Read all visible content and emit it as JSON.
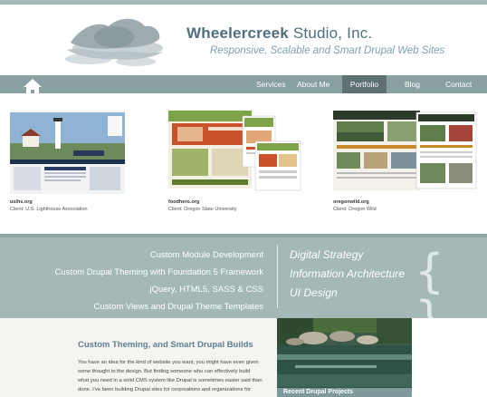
{
  "brand": {
    "title_strong": "Wheelercreek",
    "title_rest": " Studio, Inc.",
    "tagline": "Responsive, Scalable and Smart Drupal Web Sites"
  },
  "nav": {
    "items": [
      {
        "label": "Services",
        "active": false
      },
      {
        "label": "About Me",
        "active": false
      },
      {
        "label": "Portfolio",
        "active": true
      },
      {
        "label": "Blog",
        "active": false
      },
      {
        "label": "Contact",
        "active": false
      }
    ]
  },
  "portfolio": [
    {
      "title": "uslhs.org",
      "client": "Client: U.S. Lighthouse Association"
    },
    {
      "title": "foodhero.org",
      "client": "Client: Oregon State University"
    },
    {
      "title": "oregonwild.org",
      "client": "Client: Oregon Wild"
    }
  ],
  "services": {
    "items": [
      "Custom Module Development",
      "Custom Drupal Theming with Foundation 5 Framework",
      "jQuery, HTML5, SASS & CSS",
      "Custom Views and Drupal Theme Templates"
    ],
    "features": [
      "Digital Strategy",
      "Information Architecture",
      "UI Design"
    ],
    "brace": "{ }"
  },
  "content": {
    "heading": "Custom Theming, and Smart Drupal Builds",
    "body_lines": [
      "You have an idea for the kind of website you want, you might have even given",
      "some thought to the design.  But finding someone who can effectively build",
      "what you need in a solid CMS system like Drupal is sometimes easier said than",
      "done.  I've been building Drupal sites for corporations and organizations for"
    ]
  },
  "sidebar": {
    "recent_label": "Recent Drupal Projects"
  },
  "colors": {
    "nav_bg": "#88a0a1",
    "nav_active": "#5e7073",
    "band_bg": "#a3b8b7",
    "brand_blue": "#4f6f80",
    "tagline_blue": "#7ca0b3"
  }
}
